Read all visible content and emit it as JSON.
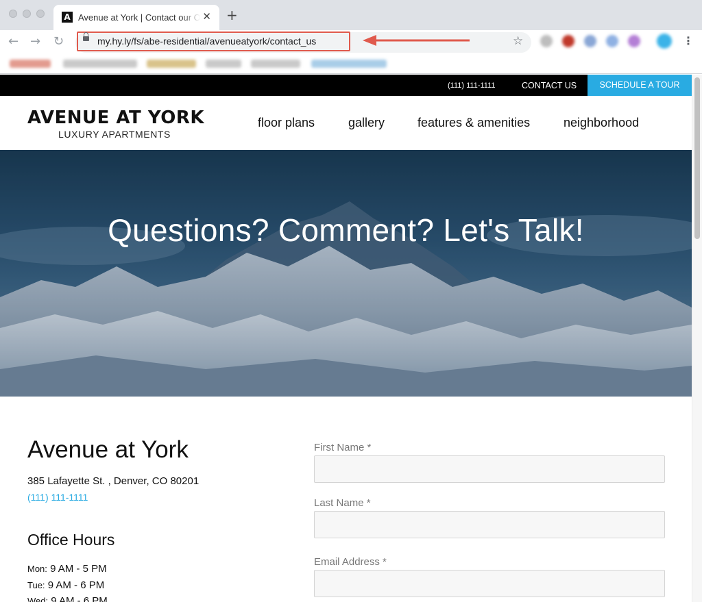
{
  "browser": {
    "tab_title": "Avenue at York | Contact our O",
    "tab_favicon": "A",
    "url": "my.hy.ly/fs/abe-residential/avenueatyork/contact_us",
    "icons": [
      "back-arrow-icon",
      "forward-arrow-icon",
      "reload-icon",
      "lock-icon",
      "bookmark-star-icon",
      "menu-dots-icon"
    ]
  },
  "topbar": {
    "phone": "(111) 111-1111",
    "contact": "CONTACT US",
    "tour": "SCHEDULE A TOUR",
    "accent": "#29abe2"
  },
  "header": {
    "logo_main": "AVENUE AT YORK",
    "logo_sub": "LUXURY APARTMENTS",
    "nav": [
      "floor plans",
      "gallery",
      "features & amenities",
      "neighborhood"
    ]
  },
  "hero": {
    "title": "Questions? Comment? Let's Talk!"
  },
  "property": {
    "name": "Avenue at York",
    "address": "385 Lafayette St. , Denver, CO 80201",
    "phone": "(111) 111-1111"
  },
  "hours": {
    "title": "Office Hours",
    "rows": [
      {
        "day": "Mon:",
        "time": "9 AM - 5 PM"
      },
      {
        "day": "Tue:",
        "time": "9 AM - 6 PM"
      },
      {
        "day": "Wed:",
        "time": "9 AM - 6 PM"
      }
    ]
  },
  "form": {
    "first_name": "First Name *",
    "last_name": "Last Name *",
    "email": "Email Address *"
  },
  "colors": {
    "annotation": "#e05a4d"
  }
}
